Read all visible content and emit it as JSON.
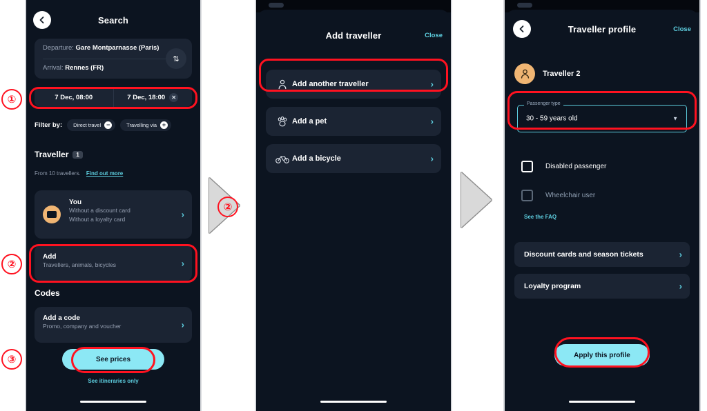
{
  "panel1": {
    "header": {
      "title": "Search",
      "back_icon": "chevron-left-icon"
    },
    "search": {
      "departure_label": "Departure:",
      "departure_value": "Gare Montparnasse (Paris)",
      "arrival_label": "Arrival:",
      "arrival_value": "Rennes (FR)",
      "swap_icon": "swap-vertical-icon",
      "date_outbound": "7 Dec, 08:00",
      "date_return": "7 Dec, 18:00",
      "date_clear_icon": "close-icon"
    },
    "filters": {
      "label": "Filter by:",
      "chips": [
        {
          "label": "Direct travel",
          "icon": "minus-circle-icon",
          "glyph": "−"
        },
        {
          "label": "Travelling via",
          "icon": "plus-circle-icon",
          "glyph": "+"
        }
      ]
    },
    "traveller": {
      "title": "Traveller",
      "count": "1",
      "note": "From 10 travellers.",
      "link": "Find out more",
      "you": {
        "name": "You",
        "line1": "Without a discount card",
        "line2": "Without a loyalty card",
        "avatar_icon": "user-avatar-icon",
        "chevron": "chevron-right-icon"
      },
      "add": {
        "title": "Add",
        "sub": "Travellers, animals, bicycles",
        "chevron": "chevron-right-icon"
      }
    },
    "codes": {
      "title": "Codes",
      "add_code_title": "Add a code",
      "add_code_sub": "Promo, company and voucher",
      "chevron": "chevron-right-icon"
    },
    "footer": {
      "cta": "See prices",
      "link": "See itineraries only"
    }
  },
  "panel2": {
    "header": {
      "title": "Add traveller",
      "close": "Close"
    },
    "options": [
      {
        "label": "Add another traveller",
        "icon": "person-icon",
        "chevron": "chevron-right-icon"
      },
      {
        "label": "Add a pet",
        "icon": "paw-icon",
        "chevron": "chevron-right-icon"
      },
      {
        "label": "Add a bicycle",
        "icon": "bicycle-icon",
        "chevron": "chevron-right-icon"
      }
    ]
  },
  "panel3": {
    "header": {
      "title": "Traveller profile",
      "close": "Close",
      "back_icon": "chevron-left-icon"
    },
    "profile": {
      "name": "Traveller 2",
      "avatar_icon": "person-avatar-icon"
    },
    "passenger_type": {
      "legend": "Passenger type",
      "value": "30 - 59 years old",
      "caret_icon": "chevron-down-icon"
    },
    "checkboxes": [
      {
        "label": "Disabled passenger",
        "checked": false,
        "state": "enabled"
      },
      {
        "label": "Wheelchair user",
        "checked": false,
        "state": "disabled"
      }
    ],
    "faq_link": "See the FAQ",
    "rows": [
      {
        "label": "Discount cards and season tickets",
        "chevron": "chevron-right-icon"
      },
      {
        "label": "Loyalty program",
        "chevron": "chevron-right-icon"
      }
    ],
    "cta": "Apply this profile"
  },
  "annotations": {
    "step1": "①",
    "step2_left": "②",
    "step3_left": "③",
    "step2_arrow": "②",
    "highlight_color": "#ff1220"
  }
}
